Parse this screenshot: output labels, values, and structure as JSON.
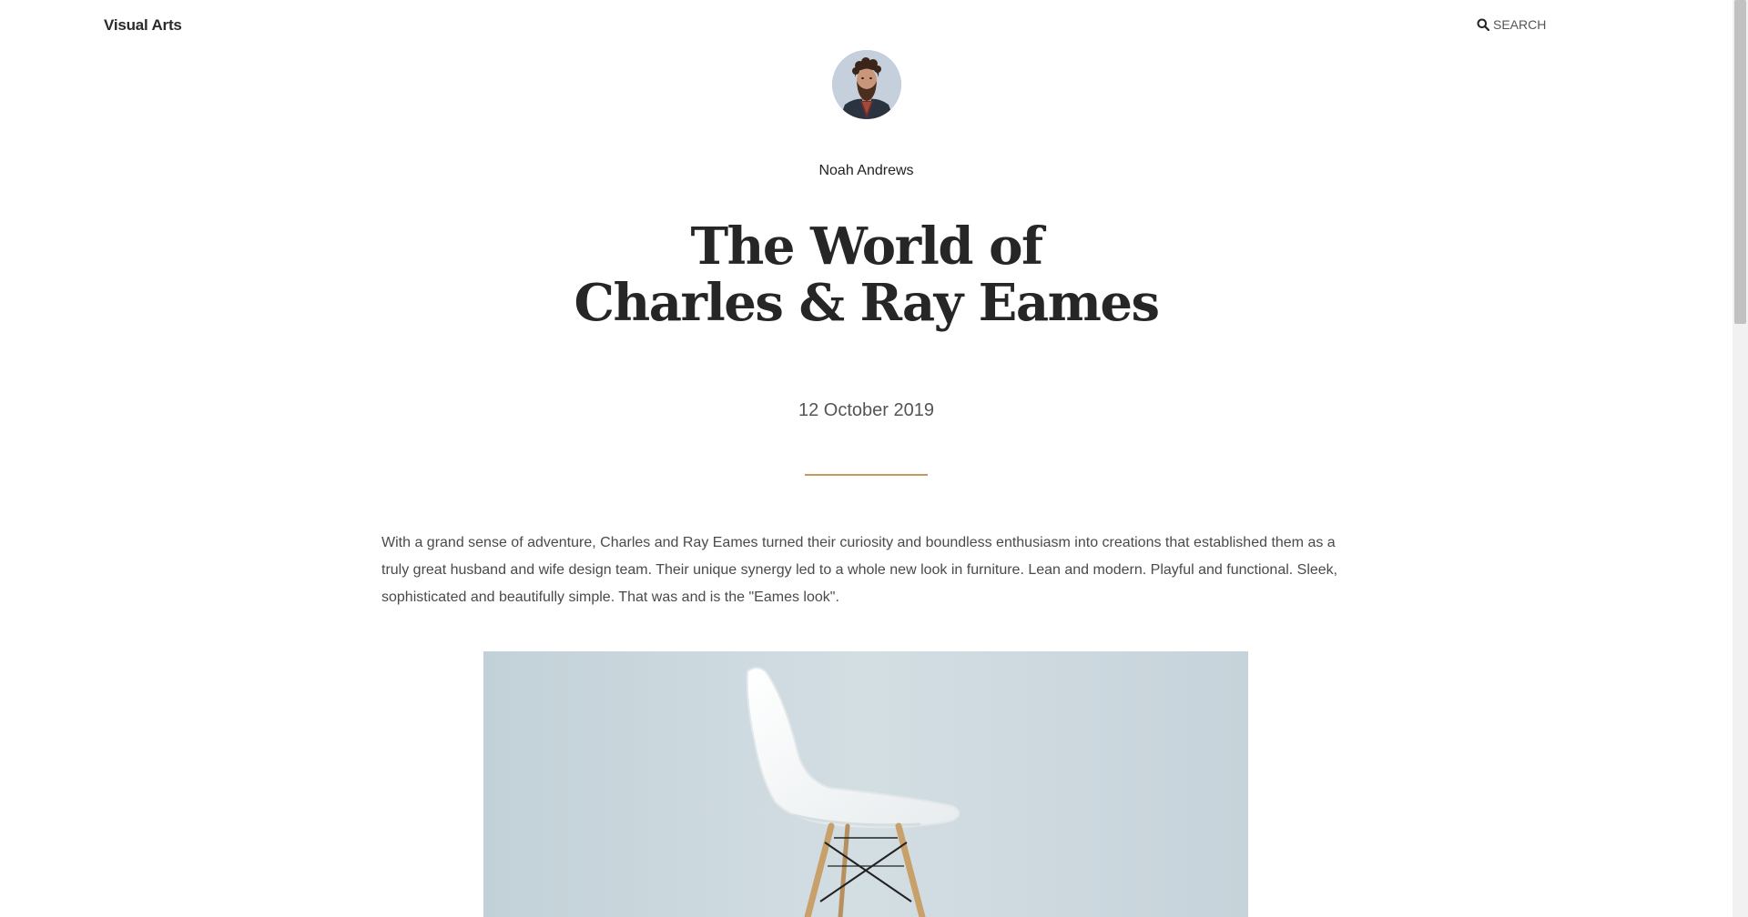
{
  "header": {
    "site_title": "Visual Arts",
    "search_label": "SEARCH"
  },
  "article": {
    "author": "Noah Andrews",
    "title_line1": "The World of",
    "title_line2": "Charles & Ray Eames",
    "date": "12 October 2019",
    "intro": "With a grand sense of adventure, Charles and Ray Eames turned their curiosity and boundless enthusiasm into creations that established them as a truly great husband and wife design team. Their unique synergy led to a whole new look in furniture. Lean and modern. Playful and functional. Sleek, sophisticated and beautifully simple. That was and is the \"Eames look\"."
  },
  "icons": {
    "search": "search-icon"
  },
  "colors": {
    "accent": "#c79a5c",
    "text": "#262626",
    "body_text": "#4a4a4a",
    "muted": "#555555"
  }
}
